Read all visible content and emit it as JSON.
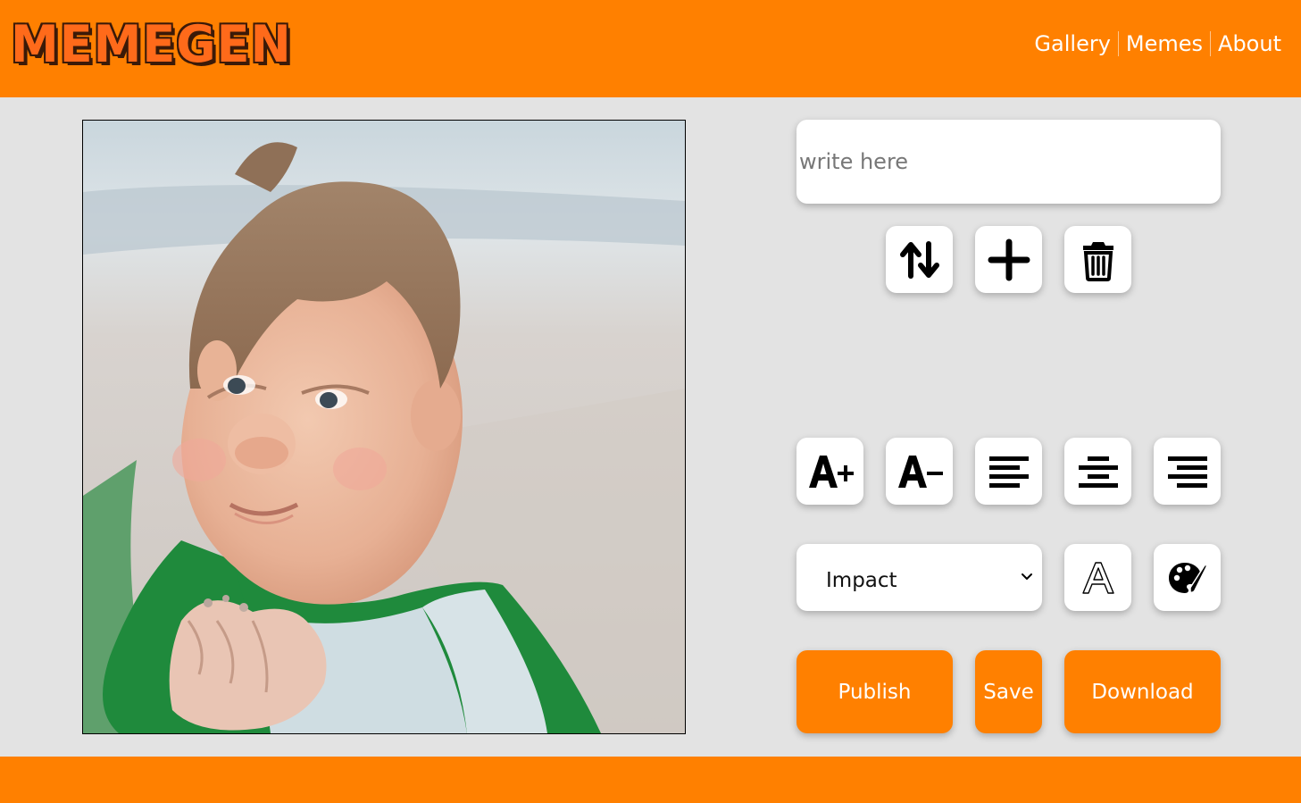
{
  "header": {
    "logo_text": "MEMEGEN",
    "nav": [
      "Gallery",
      "Memes",
      "About"
    ]
  },
  "editor": {
    "text_placeholder": "write here",
    "font_select": {
      "selected": "Impact"
    }
  },
  "actions": {
    "publish_label": "Publish",
    "save_label": "Save",
    "download_label": "Download"
  },
  "icons": [
    "switch-lines-icon",
    "add-line-icon",
    "trash-icon",
    "font-increase-icon",
    "font-decrease-icon",
    "align-left-icon",
    "align-center-icon",
    "align-right-icon",
    "chevron-down-icon",
    "font-outline-icon",
    "palette-icon"
  ],
  "colors": {
    "brand_orange": "#ff8000",
    "background": "#e3e3e3",
    "panel_white": "#ffffff"
  }
}
